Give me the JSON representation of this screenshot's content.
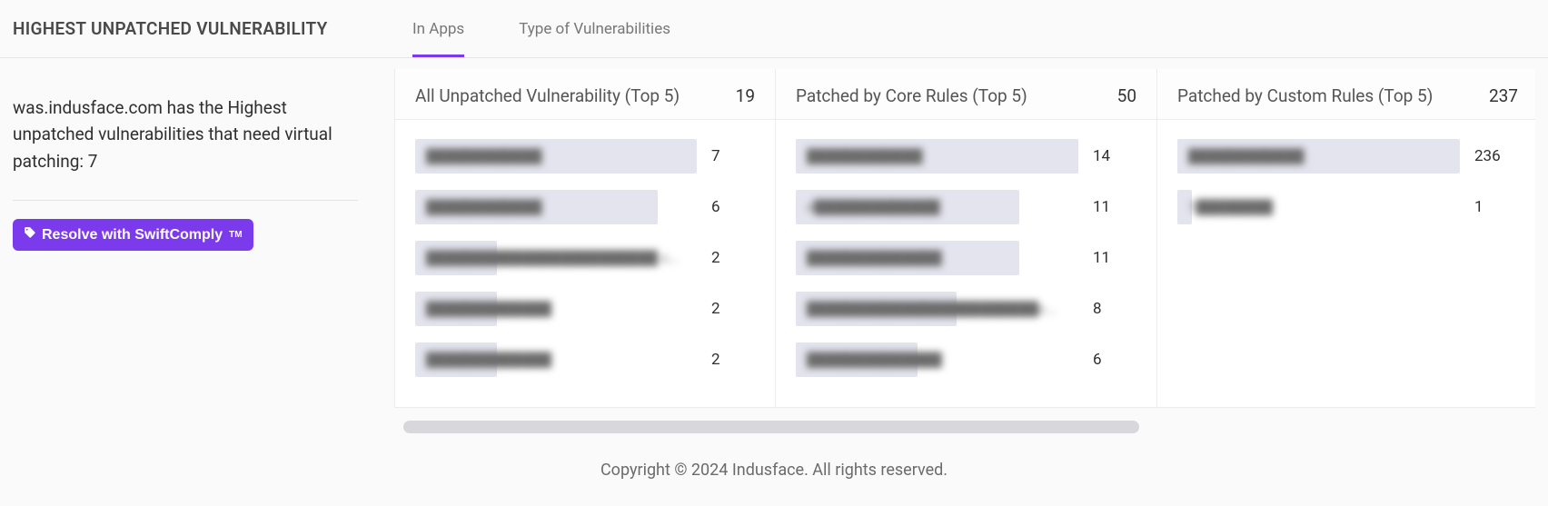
{
  "header": {
    "title": "HIGHEST UNPATCHED VULNERABILITY",
    "tabs": {
      "in_apps": "In Apps",
      "types": "Type of Vulnerabilities"
    }
  },
  "sidebar": {
    "summary": "was.indusface.com has the Highest unpatched vulnerabilities that need virtual patching: 7",
    "resolve_label": "Resolve with SwiftComply",
    "resolve_tm": "TM"
  },
  "panels": {
    "unpatched": {
      "title": "All Unpatched Vulnerability (Top 5)",
      "total": "19",
      "rows": [
        {
          "label": "████████████",
          "value": "7",
          "pct": 100
        },
        {
          "label": "████████████",
          "value": "6",
          "pct": 86
        },
        {
          "label": "████████████████████████ c...",
          "value": "2",
          "pct": 29
        },
        {
          "label": "█████████████",
          "value": "2",
          "pct": 29
        },
        {
          "label": "█████████████",
          "value": "2",
          "pct": 29
        }
      ]
    },
    "core": {
      "title": "Patched by Core Rules (Top 5)",
      "total": "50",
      "rows": [
        {
          "label": "████████████",
          "value": "14",
          "pct": 100
        },
        {
          "label": "d█████████████",
          "value": "11",
          "pct": 79
        },
        {
          "label": "██████████████",
          "value": "11",
          "pct": 79
        },
        {
          "label": "████████████████████████c...",
          "value": "8",
          "pct": 57
        },
        {
          "label": "██████████████",
          "value": "6",
          "pct": 43
        }
      ]
    },
    "custom": {
      "title": "Patched by Custom Rules (Top 5)",
      "total": "237",
      "rows": [
        {
          "label": "████████████",
          "value": "236",
          "pct": 100
        },
        {
          "label": "1████████",
          "value": "1",
          "pct": 5
        }
      ]
    }
  },
  "footer": "Copyright © 2024 Indusface. All rights reserved."
}
